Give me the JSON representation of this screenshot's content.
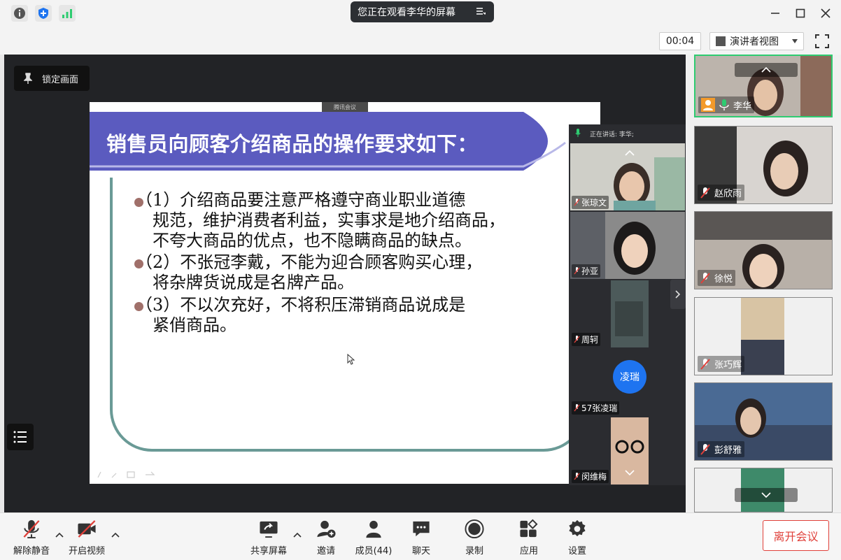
{
  "titlebar": {
    "share_notice": "您正在观看李华的屏幕"
  },
  "toolbar": {
    "timer": "00:04",
    "view_mode": "演讲者视图"
  },
  "stage": {
    "lock_label": "锁定画面",
    "slide_app_tag": "腾讯会议",
    "slide_title": "销售员向顾客介绍商品的操作要求如下：",
    "bullets": [
      {
        "lines": [
          "（1）介绍商品要注意严格遵守商业职业道德",
          "规范，维护消费者利益，实事求是地介绍商品，",
          "不夸大商品的优点，也不隐瞒商品的缺点。"
        ]
      },
      {
        "lines": [
          "（2）不张冠李戴，不能为迎合顾客购买心理，",
          "将杂牌货说成是名牌产品。"
        ]
      },
      {
        "lines": [
          "（3）不以次充好，不将积压滞销商品说成是",
          "紧俏商品。"
        ]
      }
    ],
    "speaking_now": "正在讲话: 李华;",
    "strip_tiles": [
      {
        "name": "张琼文"
      },
      {
        "name": "孙亚"
      },
      {
        "name": "周轲"
      },
      {
        "name": "57张凌瑞",
        "avatar": "凌瑞"
      },
      {
        "name": "闵维梅"
      }
    ]
  },
  "gallery": [
    {
      "name": "李华",
      "active": true
    },
    {
      "name": "赵欣雨"
    },
    {
      "name": "徐悦"
    },
    {
      "name": "张巧辉"
    },
    {
      "name": "彭舒雅"
    }
  ],
  "bottom": {
    "unmute": "解除静音",
    "start_video": "开启视频",
    "share_screen": "共享屏幕",
    "invite": "邀请",
    "members": "成员(44)",
    "chat": "聊天",
    "record": "录制",
    "apps": "应用",
    "settings": "设置",
    "leave": "离开会议"
  },
  "colors": {
    "banner": "#5b5bbf",
    "frame": "#6a9a96",
    "bullet": "#a0706a",
    "leave": "#e0403a",
    "active_border": "#2ecc71",
    "avatar": "#1e74f0"
  }
}
